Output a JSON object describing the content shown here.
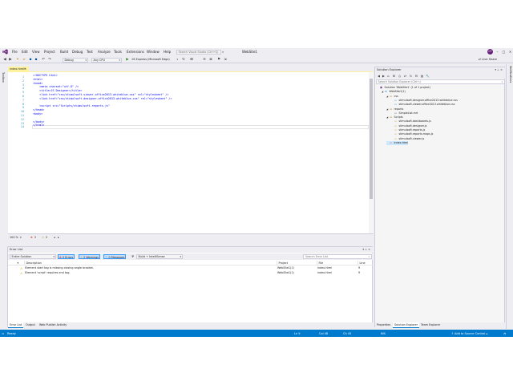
{
  "colors": {
    "accent": "#007acc",
    "vs_purple": "#68217a",
    "tab_highlight": "#fff29d",
    "warning": "#c8961e"
  },
  "menubar": {
    "items": [
      "File",
      "Edit",
      "View",
      "Project",
      "Build",
      "Debug",
      "Test",
      "Analyze",
      "Tools",
      "Extensions",
      "Window",
      "Help"
    ],
    "search_placeholder": "Search Visual Studio (Ctrl+Q)",
    "app_name": "WebSite1",
    "avatar_initials": "CT"
  },
  "toolbar": {
    "config": "Debug",
    "platform": "Any CPU",
    "run_target": "IIS Express (Microsoft Edge)",
    "live_share": "Live Share"
  },
  "left_strip": {
    "label": "Toolbox"
  },
  "right_strip": {
    "label": "Notifications"
  },
  "editor": {
    "tab_label": "index.html*",
    "line_numbers": [
      "1",
      "2",
      "3",
      "4",
      "5",
      "6",
      "7",
      "8",
      "9",
      "10",
      "11",
      "12",
      "13",
      "14"
    ],
    "lines": [
      [
        "<!DOCTYPE html>"
      ],
      [
        "<html>"
      ],
      [
        "<head>"
      ],
      [
        "    <meta charset=\"utf-8\" />"
      ],
      [
        "    <title>JS Designer</title>"
      ],
      [
        "    <link href=\"css/stimulsoft.viewer.office2013.whiteblue.css\" rel=\"stylesheet\" />"
      ],
      [
        "    <link href=\"css/stimulsoft.designer.office2013.whiteblue.css\" rel=\"stylesheet\" />"
      ],
      [
        ""
      ],
      [
        "    <script src=\"Scripts/stimulsoft.reports.js\""
      ],
      [
        "</head>"
      ],
      [
        "<body>"
      ],
      [
        ""
      ],
      [
        "</body>"
      ],
      [
        "</html>"
      ]
    ],
    "zoom": "100 %",
    "error_count": "2",
    "warning_count": "2"
  },
  "error_list": {
    "title": "Error List",
    "scope": "Entire Solution",
    "errors_btn": "0 Errors",
    "warnings_btn": "2 Warnings",
    "messages_btn": "0 Messages",
    "build_filter": "Build + IntelliSense",
    "search_placeholder": "Search Error List",
    "columns": {
      "description": "Description",
      "project": "Project",
      "file": "File",
      "line": "Line"
    },
    "rows": [
      {
        "description": "Element start tag is missing closing angle bracket.",
        "project": "WebSite1(1)",
        "file": "index.html",
        "line": "9"
      },
      {
        "description": "Element 'script' requires end tag.",
        "project": "WebSite1(1)",
        "file": "index.html",
        "line": "9"
      }
    ],
    "tabs": [
      "Error List",
      "Output",
      "Web Publish Activity"
    ]
  },
  "solution_explorer": {
    "title": "Solution Explorer",
    "search_placeholder": "Search Solution Explorer (Ctrl+;)",
    "tree": [
      {
        "label": "Solution 'WebSite1' (1 of 1 project)",
        "icon": "solution-icon",
        "glyph": "▣",
        "depth": 0,
        "twisty": ""
      },
      {
        "label": "WebSite1(1)",
        "icon": "web-project-icon",
        "glyph": "⊕",
        "depth": 1,
        "twisty": "◢"
      },
      {
        "label": "css",
        "icon": "folder-icon",
        "glyph": "▬",
        "depth": 2,
        "twisty": "◢"
      },
      {
        "label": "stimulsoft.designer.office2013.whiteblue.css",
        "icon": "css-file-icon",
        "glyph": "▫",
        "depth": 3,
        "twisty": ""
      },
      {
        "label": "stimulsoft.viewer.office2013.whiteblue.css",
        "icon": "css-file-icon",
        "glyph": "▫",
        "depth": 3,
        "twisty": ""
      },
      {
        "label": "reports",
        "icon": "folder-icon",
        "glyph": "▬",
        "depth": 2,
        "twisty": "◢"
      },
      {
        "label": "SimpleList.mrt",
        "icon": "file-icon",
        "glyph": "▫",
        "depth": 3,
        "twisty": ""
      },
      {
        "label": "Scripts",
        "icon": "folder-icon",
        "glyph": "▬",
        "depth": 2,
        "twisty": "◢"
      },
      {
        "label": "stimulsoft.dashboards.js",
        "icon": "js-file-icon",
        "glyph": "▫",
        "depth": 3,
        "twisty": ""
      },
      {
        "label": "stimulsoft.designer.js",
        "icon": "js-file-icon",
        "glyph": "▫",
        "depth": 3,
        "twisty": ""
      },
      {
        "label": "stimulsoft.reports.js",
        "icon": "js-file-icon",
        "glyph": "▫",
        "depth": 3,
        "twisty": ""
      },
      {
        "label": "stimulsoft.reports.maps.js",
        "icon": "js-file-icon",
        "glyph": "▫",
        "depth": 3,
        "twisty": ""
      },
      {
        "label": "stimulsoft.viewer.js",
        "icon": "js-file-icon",
        "glyph": "▫",
        "depth": 3,
        "twisty": ""
      },
      {
        "label": "index.html",
        "icon": "html-file-icon",
        "glyph": "▫",
        "depth": 2,
        "twisty": "",
        "selected": true
      }
    ],
    "tabs": [
      "Properties",
      "Solution Explorer",
      "Team Explorer"
    ]
  },
  "statusbar": {
    "ready": "Ready",
    "ln": "Ln 9",
    "col": "Col 48",
    "ch": "Ch 45",
    "ins": "INS",
    "source_control": "Add to Source Control"
  }
}
